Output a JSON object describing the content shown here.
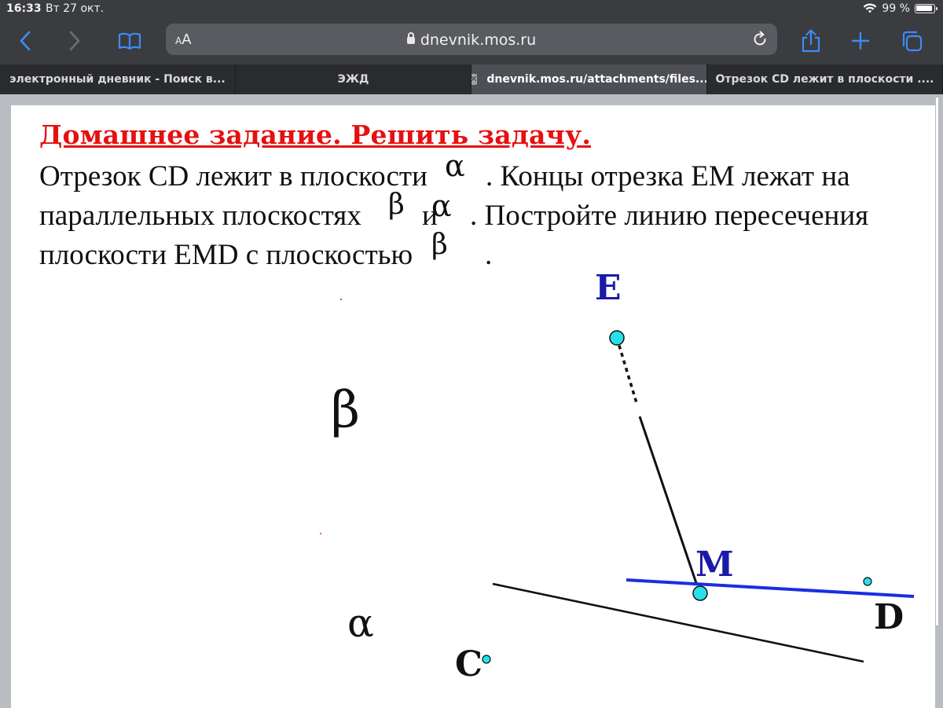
{
  "status_bar": {
    "time": "16:33",
    "date": "Вт 27 окт.",
    "battery": "99 %"
  },
  "toolbar": {
    "aa_small": "A",
    "aa_large": "A",
    "url": "dnevnik.mos.ru",
    "icons": [
      "back-icon",
      "forward-icon",
      "bookmarks-icon",
      "lock-icon",
      "reload-icon",
      "share-icon",
      "new-tab-icon",
      "tabs-icon"
    ]
  },
  "tabs": [
    {
      "label": "электронный дневник - Поиск в...",
      "active": false
    },
    {
      "label": "ЭЖД",
      "active": false
    },
    {
      "label": "dnevnik.mos.ru/attachments/files...",
      "active": true
    },
    {
      "label": "Отрезок CD лежит в плоскости ....",
      "active": false
    }
  ],
  "content": {
    "title": "Домашнее задание. Решить задачу",
    "title_dot": ".",
    "line1_a": "Отрезок CD лежит в плоскости",
    "line1_b": ". Концы отрезка ЕМ лежат на",
    "line2_a": "параллельных плоскостях",
    "line2_b": "и",
    "line2_c": ".  Постройте линию пересечения",
    "line3_a": "плоскости EMD с плоскостью",
    "line3_b": ".",
    "sym_alpha": "α",
    "sym_beta": "β"
  },
  "figure": {
    "label_E": "E",
    "label_M": "M",
    "label_D": "D",
    "label_C": "C",
    "plane_beta": "β",
    "plane_alpha": "α",
    "colors": {
      "point_fill": "#27e0ea",
      "blue_line": "#1a2ee0",
      "label_blue": "#1a1aa8",
      "title_red": "#e61010"
    }
  }
}
